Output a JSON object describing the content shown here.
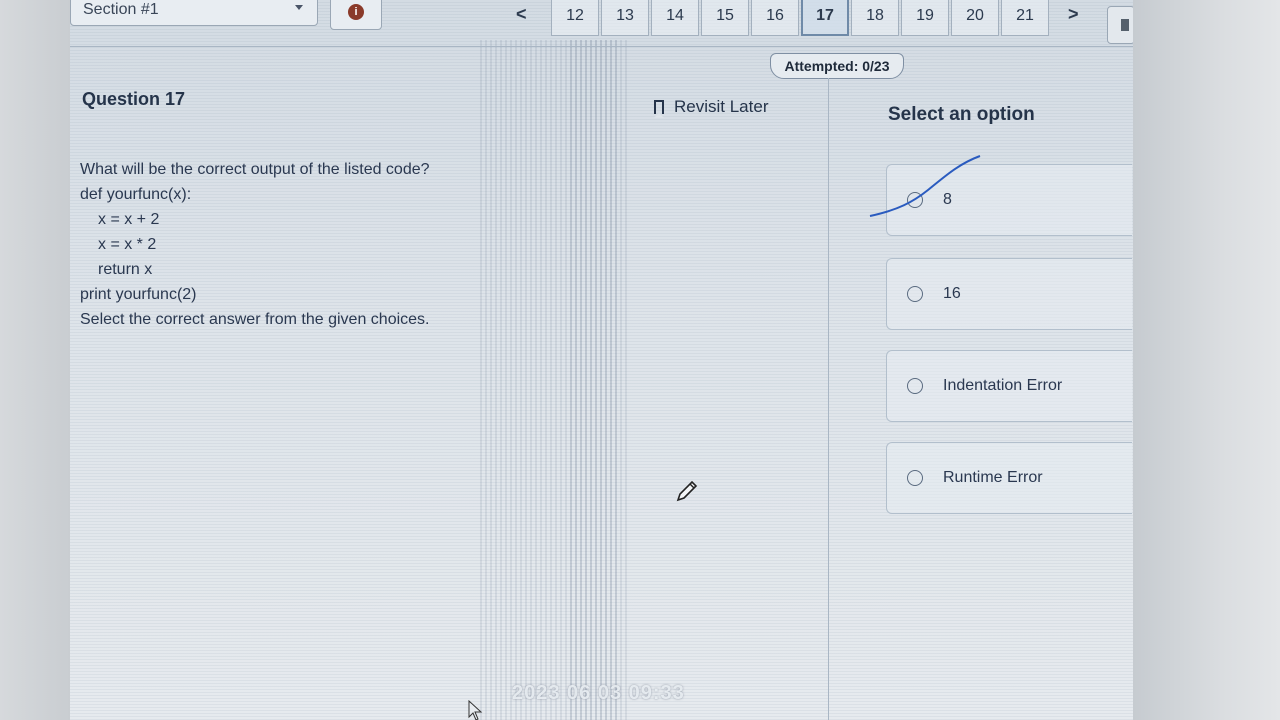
{
  "header": {
    "section_label": "Section #1",
    "info_symbol": "i",
    "prev_symbol": "<",
    "next_symbol": ">",
    "question_numbers": [
      "12",
      "13",
      "14",
      "15",
      "16",
      "17",
      "18",
      "19",
      "20",
      "21"
    ],
    "active_question": "17",
    "attempted": "Attempted: 0/23"
  },
  "question": {
    "title": "Question 17",
    "revisit_label": "Revisit Later",
    "lines": [
      "What will be the correct output of the listed code?",
      "def yourfunc(x):",
      "x = x + 2",
      "x = x * 2",
      "return x",
      "print yourfunc(2)",
      "Select the correct answer from the given choices."
    ]
  },
  "options": {
    "title": "Select an option",
    "items": [
      "8",
      "16",
      "Indentation Error",
      "Runtime Error"
    ]
  },
  "overlay": {
    "timestamp": "2023 06 03 09:33"
  },
  "colors": {
    "accent": "#6f8aa8",
    "pen_stroke": "#2a5bbf"
  }
}
